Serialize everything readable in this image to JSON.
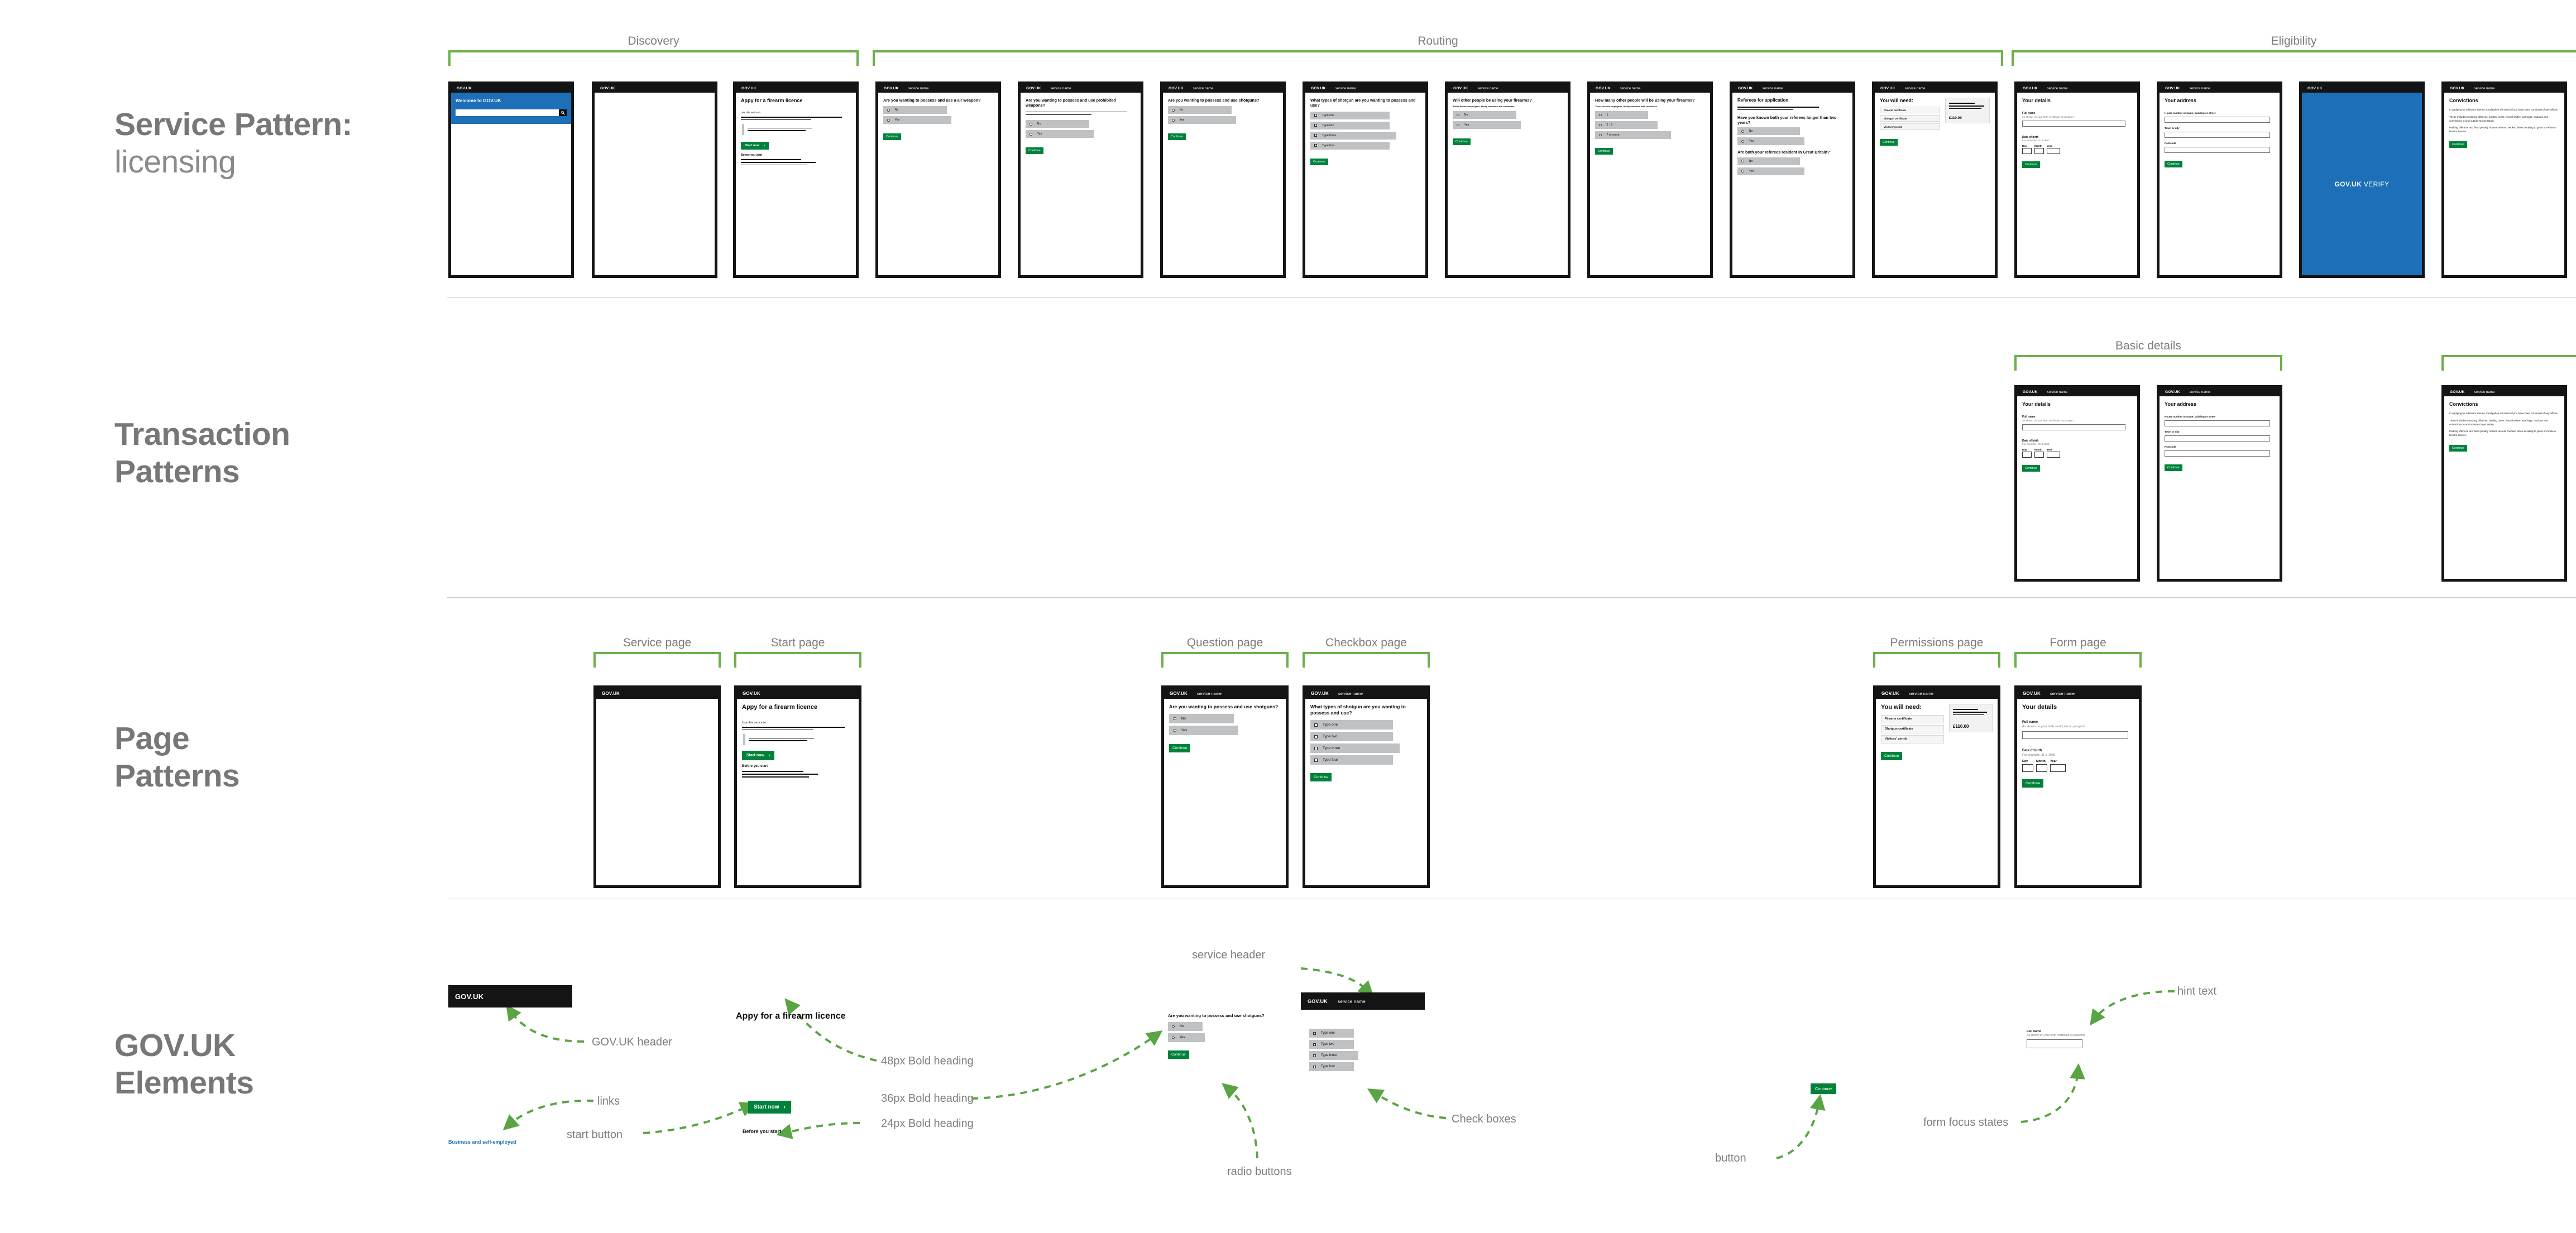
{
  "row_labels": [
    {
      "strong": "Service Pattern:",
      "light": "licensing"
    },
    {
      "strong": "Transaction Patterns",
      "light": ""
    },
    {
      "strong": "Page Patterns",
      "light": ""
    },
    {
      "strong": "GOV.UK Elements",
      "light": ""
    }
  ],
  "groups": {
    "discovery": "Discovery",
    "routing": "Routing",
    "eligibility": "Eligibility",
    "basic_details": "Basic details",
    "service_page": "Service page",
    "start_page": "Start page",
    "question_page": "Question page",
    "checkbox_page": "Checkbox page",
    "permissions_page": "Permissions page",
    "form_page": "Form page"
  },
  "common": {
    "brand": "GOV.UK",
    "service_name": "service name",
    "continue": "Continue",
    "start_now": "Start now",
    "chevron": "›",
    "yes": "Yes",
    "no": "No"
  },
  "homepage": {
    "brand": "GOV.UK",
    "hero_title": "Welcome to GOV.UK",
    "search_placeholder": "",
    "search_icon": "search-icon"
  },
  "start_page": {
    "brand": "GOV.UK",
    "heading": "Appy for a firearm licence",
    "use_this_service": "Use this serice to:",
    "before_you_start": "Before you start",
    "start_now": "Start now"
  },
  "q_air_weapon": {
    "heading": "Are you wanting to possess and use a air weapon?",
    "options": [
      "No",
      "Yes"
    ]
  },
  "q_prohibited": {
    "heading": "Are you wanting to possess and use prohibited weapons?",
    "options": [
      "No",
      "Yes"
    ]
  },
  "q_shotguns": {
    "heading": "Are you wanting to possess and use shotguns?",
    "options": [
      "No",
      "Yes"
    ]
  },
  "q_shotgun_types": {
    "heading": "What types of shotgun are you wanting to possess and use?",
    "options": [
      "Type one",
      "Type two",
      "Type three",
      "Type four"
    ]
  },
  "q_other_people": {
    "heading": "Will other people be using your firearms?",
    "hint": "These include employees, family members and customers.",
    "options": [
      "No",
      "Yes"
    ]
  },
  "q_how_many": {
    "heading": "How many other people will be using your firearms?",
    "hint": "These include employees, family members and customers.",
    "options": [
      "1",
      "2 - 6",
      "7 or more"
    ]
  },
  "referees": {
    "heading": "Referees for application",
    "q1": "Have you known both your referees longer than two years?",
    "q1_options": [
      "No",
      "Yes"
    ],
    "q2": "Are both your referees resident in Great Britain?",
    "q2_options": [
      "No",
      "Yes"
    ]
  },
  "permissions": {
    "heading": "You will need:",
    "items": [
      "Firearm certificate",
      "Shotgun certificate",
      "Visitors' permit"
    ],
    "price": "£110.00"
  },
  "your_details": {
    "heading": "Your details",
    "full_name_label": "Full name",
    "full_name_hint": "As shown on your birth certificate or passport",
    "full_name_value": "",
    "dob_label": "Date of birth",
    "dob_hint": "For example, 31 3 1980",
    "day": "Day",
    "month": "Month",
    "year": "Year",
    "day_value": "",
    "month_value": "",
    "year_value": ""
  },
  "your_address": {
    "heading": "Your address",
    "street_label": "House number or name, building or street",
    "street_value": "",
    "town_label": "Town or city",
    "town_value": "",
    "postcode_label": "Postcode",
    "postcode_value": ""
  },
  "verify": {
    "brand": "GOV.UK",
    "logo_bold": "GOV.UK",
    "logo_light": "VERIFY"
  },
  "convictions": {
    "heading": "Convictions",
    "paragraphs": [
      "In applying for a firearm licence, local police will check if you have been convicted of any offices.",
      "These includes motoring offences, binding overs, formal written warnings, cautions and convictions in and outside Great Britain.",
      "Parking offences and fixed penalty notices are not checked when deciding to grant or refuse a firearm licence."
    ]
  },
  "elements": {
    "govuk_header_label": "GOV.UK header",
    "links_label": "links",
    "start_button_label": "start button",
    "heading48_label": "48px Bold heading",
    "heading36_label": "36px Bold heading",
    "heading24_label": "24px Bold heading",
    "service_header_label": "service header",
    "radio_buttons_label": "radio buttons",
    "check_boxes_label": "Check boxes",
    "button_label": "button",
    "form_focus_states_label": "form focus states",
    "hint_text_label": "hint text",
    "link_sample": "Business and self-employed",
    "h48_sample": "Appy for a firearm licence",
    "h24_sample": "Before you start",
    "start_now": "Start now",
    "continue": "Continue",
    "question_sample": "Are you wanting to possess and use shotguns?",
    "radio_options": [
      "No",
      "Yes"
    ],
    "checkbox_options": [
      "Type one",
      "Type two",
      "Type three",
      "Type four"
    ],
    "full_name_label": "Full name",
    "full_name_hint": "As shown on your birth certificate or passport"
  },
  "colors": {
    "govuk_black": "#141414",
    "govuk_green": "#00823b",
    "govuk_blue": "#1d70b8",
    "accent_green": "#6cb04b",
    "grey_option": "#bfc1c3",
    "label_grey": "#7d7d7d"
  }
}
